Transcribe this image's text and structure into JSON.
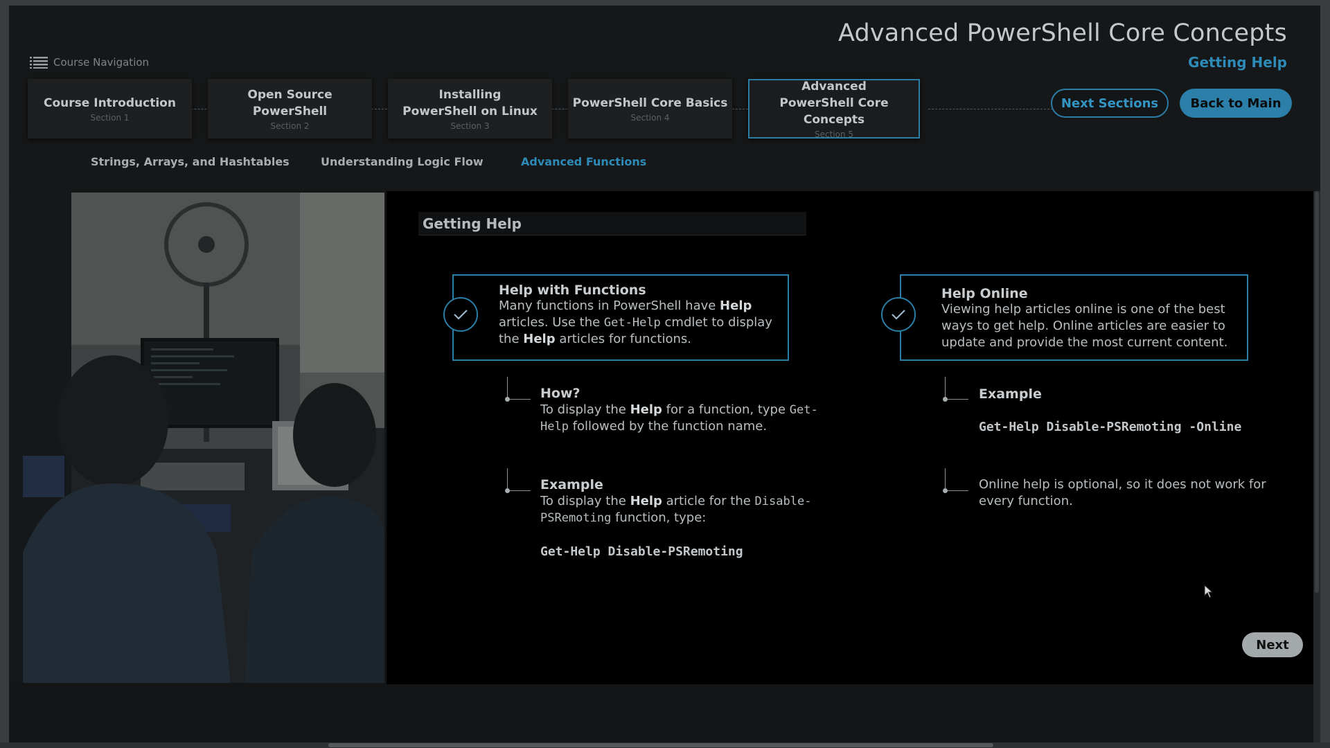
{
  "header": {
    "title": "Advanced PowerShell Core Concepts",
    "subtitle": "Getting Help",
    "course_nav_label": "Course Navigation",
    "next_sections_label": "Next Sections",
    "back_to_main_label": "Back to Main"
  },
  "sections": [
    {
      "name": "Course Introduction",
      "sub": "Section 1"
    },
    {
      "name": "Open Source PowerShell",
      "sub": "Section 2"
    },
    {
      "name": "Installing PowerShell on Linux",
      "sub": "Section 3"
    },
    {
      "name": "PowerShell Core Basics",
      "sub": "Section 4"
    },
    {
      "name": "Advanced PowerShell Core Concepts",
      "sub": "Section 5"
    }
  ],
  "subtabs": [
    {
      "label": "Strings, Arrays, and Hashtables"
    },
    {
      "label": "Understanding Logic Flow"
    },
    {
      "label": "Advanced Functions"
    }
  ],
  "content": {
    "heading": "Getting Help",
    "left_card": {
      "title": "Help with Functions",
      "t1": "Many functions in PowerShell have ",
      "b1": "Help",
      "t2": " articles. Use the ",
      "c1": "Get-Help",
      "t3": " cmdlet to display the ",
      "b2": "Help",
      "t4": " articles for functions."
    },
    "right_card": {
      "title": "Help Online",
      "body": "Viewing help articles online is one of the best ways to get help. Online articles are easier to update and provide the most current content."
    },
    "how": {
      "title": "How?",
      "t1": "To display the ",
      "b1": "Help",
      "t2": " for a function, type ",
      "c1": "Get-Help",
      "t3": " followed by the function name."
    },
    "example_left": {
      "title": "Example",
      "t1": "To display the ",
      "b1": "Help",
      "t2": " article for the ",
      "c1": "Disable-PSRemoting",
      "t3": " function, type:",
      "code": "Get-Help Disable-PSRemoting"
    },
    "example_right": {
      "title": "Example",
      "code": "Get-Help Disable-PSRemoting -Online"
    },
    "note": "Online help is optional, so it does not work for every function.",
    "next_label": "Next"
  },
  "icons": {
    "nav": "list-icon",
    "check": "checkmark-icon",
    "cursor": "mouse-pointer-icon"
  },
  "colors": {
    "accent": "#2a7ea6",
    "accent_text": "#2d8bb8",
    "background": "#141516"
  }
}
